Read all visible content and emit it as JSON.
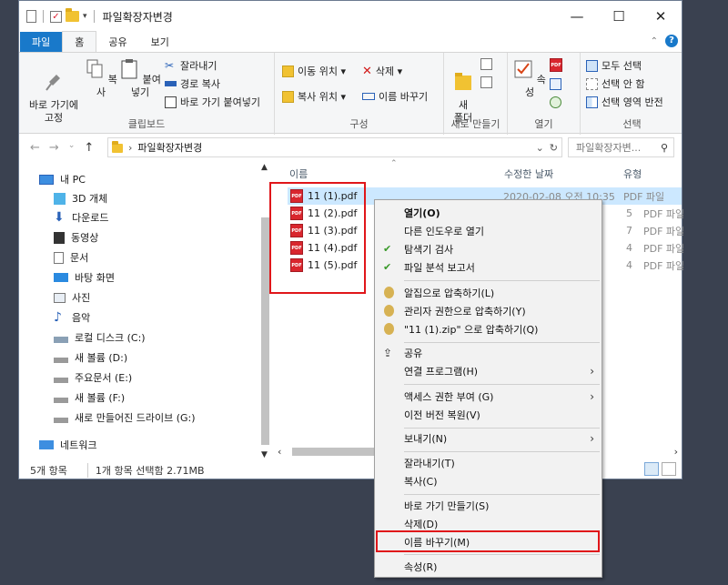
{
  "window": {
    "title": "파일확장자변경",
    "controls": {
      "minimize": "—",
      "maximize": "☐",
      "close": "✕"
    }
  },
  "ribbon_tabs": [
    "파일",
    "홈",
    "공유",
    "보기"
  ],
  "ribbon": {
    "clipboard": {
      "label": "클립보드",
      "pin": "바로 가기에\n고정",
      "copy": "복사",
      "paste": "붙여넣기",
      "cut": "잘라내기",
      "copy_path": "경로 복사",
      "paste_shortcut": "바로 가기 붙여넣기"
    },
    "organize": {
      "label": "구성",
      "move_to": "이동 위치 ▾",
      "copy_to": "복사 위치 ▾",
      "delete": "삭제 ▾",
      "rename": "이름 바꾸기"
    },
    "new": {
      "label": "새로 만들기",
      "new_folder": "새\n폴더"
    },
    "open": {
      "label": "열기",
      "properties": "속성"
    },
    "select": {
      "label": "선택",
      "select_all": "모두 선택",
      "select_none": "선택 안 함",
      "invert": "선택 영역 반전"
    }
  },
  "address": {
    "path": "파일확장자변경",
    "search_placeholder": "파일확장자변...",
    "dropdown": "⌄",
    "refresh": "↻"
  },
  "nav_pane": [
    {
      "label": "내 PC",
      "icon": "pc-icon"
    },
    {
      "label": "3D 개체",
      "icon": "cube-icon"
    },
    {
      "label": "다운로드",
      "icon": "download-icon"
    },
    {
      "label": "동영상",
      "icon": "video-icon"
    },
    {
      "label": "문서",
      "icon": "document-icon"
    },
    {
      "label": "바탕 화면",
      "icon": "desktop-icon"
    },
    {
      "label": "사진",
      "icon": "picture-icon"
    },
    {
      "label": "음악",
      "icon": "music-icon"
    },
    {
      "label": "로컬 디스크 (C:)",
      "icon": "drive-icon"
    },
    {
      "label": "새 볼륨 (D:)",
      "icon": "drive-icon"
    },
    {
      "label": "주요문서 (E:)",
      "icon": "drive-icon"
    },
    {
      "label": "새 볼륨 (F:)",
      "icon": "drive-icon"
    },
    {
      "label": "새로 만들어진 드라이브 (G:)",
      "icon": "drive-icon"
    },
    {
      "label": "네트워크",
      "icon": "network-icon"
    }
  ],
  "columns": {
    "name": "이름",
    "date": "수정한 날짜",
    "type": "유형"
  },
  "files": [
    {
      "name": "11 (1).pdf",
      "date": "2020-02-08 오전 10:35",
      "type": "PDF 파일"
    },
    {
      "name": "11 (2).pdf",
      "date": "5",
      "type": "PDF 파일"
    },
    {
      "name": "11 (3).pdf",
      "date": "7",
      "type": "PDF 파일"
    },
    {
      "name": "11 (4).pdf",
      "date": "4",
      "type": "PDF 파일"
    },
    {
      "name": "11 (5).pdf",
      "date": "4",
      "type": "PDF 파일"
    }
  ],
  "status": {
    "count": "5개 항목",
    "selected": "1개 항목 선택함 2.71MB"
  },
  "context_menu": {
    "open": "열기(O)",
    "open_new_window": "다른 인도우로 열기",
    "scan": "탐색기 검사",
    "analyze": "파일 분석 보고서",
    "compress": "알집으로 압축하기(L)",
    "compress_admin": "관리자 권한으로 압축하기(Y)",
    "compress_zip": "\"11 (1).zip\" 으로 압축하기(Q)",
    "share": "공유",
    "open_with": "연결 프로그램(H)",
    "grant_access": "액세스 권한 부여 (G)",
    "restore": "이전 버전 복원(V)",
    "send_to": "보내기(N)",
    "cut": "잘라내기(T)",
    "copy": "복사(C)",
    "create_shortcut": "바로 가기 만들기(S)",
    "delete": "삭제(D)",
    "rename": "이름 바꾸기(M)",
    "properties": "속성(R)"
  },
  "colors": {
    "accent": "#1979ca",
    "highlight_box": "#e0161a",
    "selection": "#cce8ff"
  }
}
